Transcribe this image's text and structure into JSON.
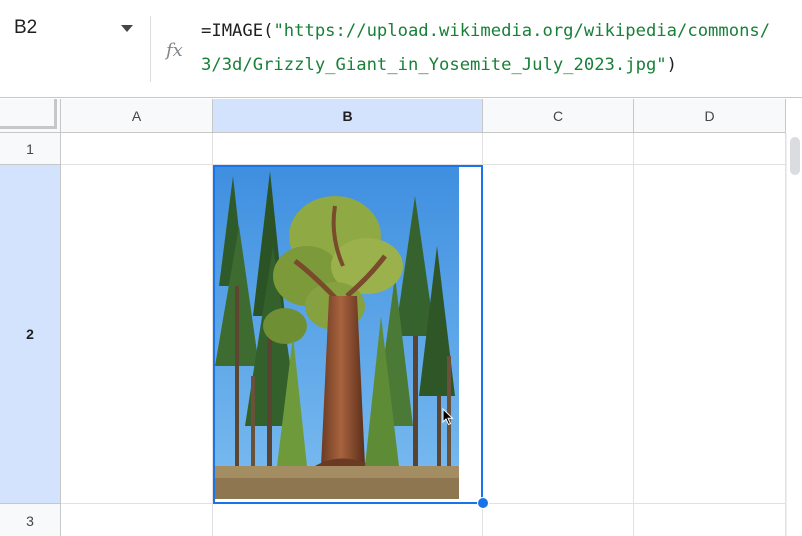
{
  "name_box": {
    "value": "B2"
  },
  "formula_bar": {
    "fx_label": "fx",
    "line1_prefix": "=IMAGE(",
    "line1_string": "\"https://upload.wikimedia.org/wikipedia/commons/",
    "line2_string": "3/3d/Grizzly_Giant_in_Yosemite_July_2023.jpg\"",
    "line2_suffix": ")"
  },
  "columns": [
    {
      "label": "A",
      "selected": false
    },
    {
      "label": "B",
      "selected": true
    },
    {
      "label": "C",
      "selected": false
    },
    {
      "label": "D",
      "selected": false
    }
  ],
  "rows": [
    {
      "label": "1",
      "selected": false
    },
    {
      "label": "2",
      "selected": true
    },
    {
      "label": "3",
      "selected": false
    }
  ],
  "active_cell": "B2",
  "cell_image": {
    "description": "Grizzly Giant sequoia tree",
    "sky_color": "#4a9be0"
  },
  "colors": {
    "accent": "#1a73e8",
    "selected_header": "#d3e3fd",
    "formula_string": "#188038"
  }
}
